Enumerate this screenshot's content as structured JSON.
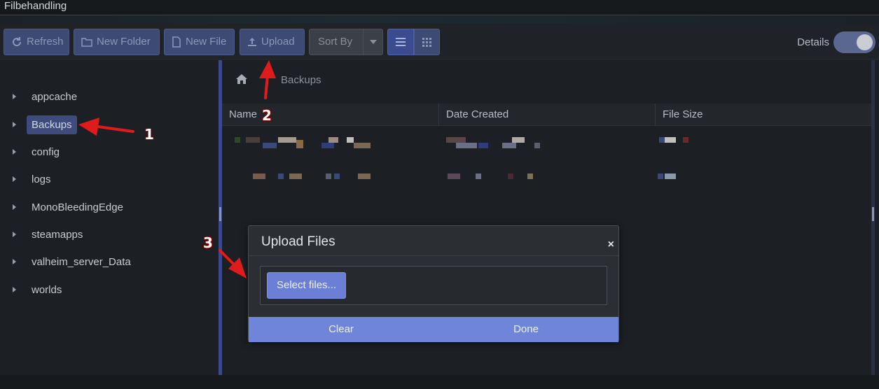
{
  "window": {
    "title": "Filbehandling"
  },
  "toolbar": {
    "refresh_label": "Refresh",
    "new_folder_label": "New Folder",
    "new_file_label": "New File",
    "upload_label": "Upload",
    "sort_by_label": "Sort By",
    "details_label": "Details",
    "details_on": true
  },
  "sidebar": {
    "items": [
      {
        "label": "appcache",
        "selected": false
      },
      {
        "label": "Backups",
        "selected": true
      },
      {
        "label": "config",
        "selected": false
      },
      {
        "label": "logs",
        "selected": false
      },
      {
        "label": "MonoBleedingEdge",
        "selected": false
      },
      {
        "label": "steamapps",
        "selected": false
      },
      {
        "label": "valheim_server_Data",
        "selected": false
      },
      {
        "label": "worlds",
        "selected": false
      }
    ]
  },
  "breadcrumb": {
    "current": "Backups"
  },
  "grid": {
    "columns": {
      "name": "Name",
      "date_created": "Date Created",
      "file_size": "File Size"
    }
  },
  "modal": {
    "title": "Upload Files",
    "close_symbol": "×",
    "select_files_label": "Select files...",
    "clear_label": "Clear",
    "done_label": "Done"
  },
  "annotations": {
    "one": "1",
    "two": "2",
    "three": "3"
  },
  "colors": {
    "accent": "#6f85d9",
    "selected": "#3d4b7d",
    "arrow": "#e01b1b"
  }
}
